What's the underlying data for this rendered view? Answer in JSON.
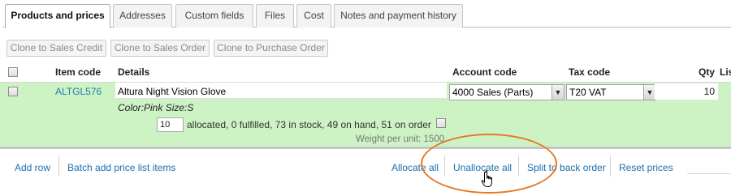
{
  "tabs": [
    {
      "label": "Products and prices",
      "active": true
    },
    {
      "label": "Addresses",
      "active": false
    },
    {
      "label": "Custom fields",
      "active": false
    },
    {
      "label": "Files",
      "active": false
    },
    {
      "label": "Cost",
      "active": false
    },
    {
      "label": "Notes and payment history",
      "active": false
    }
  ],
  "clone_buttons": {
    "sales_credit": "Clone to Sales Credit",
    "sales_order": "Clone to Sales Order",
    "purchase_order": "Clone to Purchase Order"
  },
  "table_headers": {
    "item_code": "Item code",
    "details": "Details",
    "account_code": "Account code",
    "tax_code": "Tax code",
    "qty": "Qty",
    "list_price_partial": "Lis"
  },
  "row": {
    "item_code": "ALTGL576",
    "details": "Altura Night Vision Glove",
    "account_code": "4000 Sales (Parts)",
    "tax_code": "T20 VAT",
    "qty": "10",
    "variant": "Color:Pink Size:S",
    "allocate_qty": "10",
    "stock_status": "allocated, 0 fulfilled, 73 in stock, 49 on hand, 51 on order",
    "weight": "Weight per unit: 1500"
  },
  "actions": {
    "add_row": "Add row",
    "batch_add": "Batch add price list items",
    "allocate_all": "Allocate all",
    "unallocate_all": "Unallocate all",
    "split_to_back_order": "Split to back order",
    "reset_prices": "Reset prices"
  },
  "colors": {
    "row_highlight": "#cdf3c4",
    "link": "#1a6fae",
    "annotation": "#e87722"
  },
  "icons": {
    "dropdown": "chevron-down-icon",
    "cursor": "hand-pointer-icon"
  }
}
